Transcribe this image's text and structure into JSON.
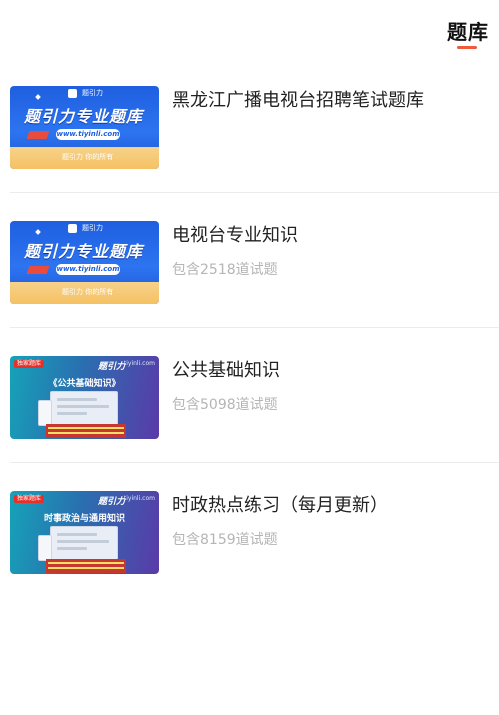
{
  "header": {
    "tab_label": "题库",
    "accent_color": "#ef5a3c"
  },
  "items": [
    {
      "title": "黑龙江广播电视台招聘笔试题库",
      "subtitle": "",
      "thumb": {
        "style": "blue",
        "top_text": "题引力",
        "main_text": "题引力专业题库",
        "url": "www.tiyinli.com",
        "bottom_text": "题引力 你的所有"
      }
    },
    {
      "title": "电视台专业知识",
      "subtitle": "包含2518道试题",
      "thumb": {
        "style": "blue",
        "top_text": "题引力",
        "main_text": "题引力专业题库",
        "url": "www.tiyinli.com",
        "bottom_text": "题引力 你的所有"
      }
    },
    {
      "title": "公共基础知识",
      "subtitle": "包含5098道试题",
      "thumb": {
        "style": "purple",
        "tag": "独家题库",
        "brand": "题引力",
        "site": "tiyinli.com",
        "heading": "《公共基础知识》"
      }
    },
    {
      "title": "时政热点练习（每月更新）",
      "subtitle": "包含8159道试题",
      "thumb": {
        "style": "purple",
        "tag": "独家题库",
        "brand": "题引力",
        "site": "tiyinli.com",
        "heading": "时事政治与通用知识"
      }
    }
  ]
}
